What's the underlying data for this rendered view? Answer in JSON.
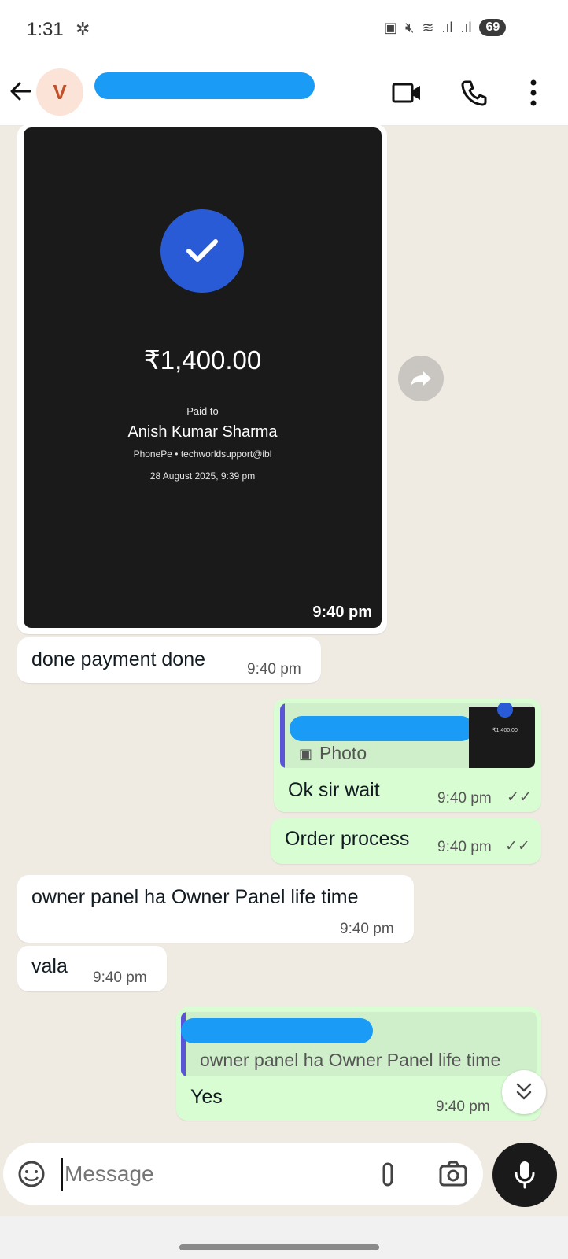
{
  "status_bar": {
    "time": "1:31",
    "battery": "69"
  },
  "header": {
    "avatar_initial": "V"
  },
  "messages": {
    "receipt": {
      "amount": "₹1,400.00",
      "paid_to_label": "Paid to",
      "payee": "Anish Kumar Sharma",
      "app_line": "PhonePe • techworldsupport@ibl",
      "date": "28 August 2025, 9:39 pm",
      "time": "9:40 pm"
    },
    "m1": {
      "text": "done payment done",
      "time": "9:40 pm"
    },
    "m2": {
      "quote_type": "Photo",
      "thumb_amount": "₹1,400.00",
      "text": "Ok sir wait",
      "time": "9:40 pm"
    },
    "m3": {
      "text": "Order process",
      "time": "9:40 pm"
    },
    "m4": {
      "text": "owner panel ha Owner Panel life time",
      "time": "9:40 pm"
    },
    "m5": {
      "text": "vala",
      "time": "9:40 pm"
    },
    "m6": {
      "quote_text": "owner panel ha Owner Panel life time",
      "text": "Yes",
      "time": "9:40 pm"
    }
  },
  "composer": {
    "placeholder": "Message"
  },
  "colors": {
    "outgoing": "#d9fdd3",
    "incoming": "#ffffff",
    "redaction": "#1a9bf5",
    "check": "#2a5bd7",
    "quote_bar": "#5b54d6"
  }
}
